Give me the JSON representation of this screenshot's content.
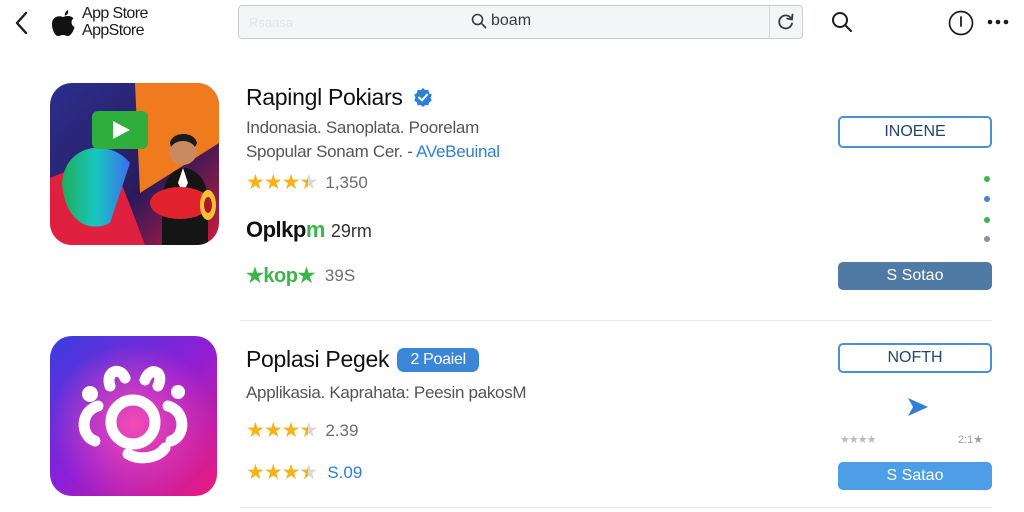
{
  "topbar": {
    "brand_line1": "App Store",
    "brand_line2": "AppStore",
    "search_placeholder": "Rsaasa",
    "search_query": "boam"
  },
  "apps": [
    {
      "title": "Rapingl Pokiars",
      "subtitle_line1": "Indonasia. Sanoplata. Poorelam",
      "subtitle_line2_prefix": "Spopular Sonam Cer. -",
      "subtitle_link": "AVeBeuinal",
      "rating_stars": 3.5,
      "rating_count": "1,350",
      "price_label": "Oplkp",
      "price_suffix": "m",
      "size": "29rm",
      "secondary_rating_label": "★kop★",
      "secondary_rating_value": "39S",
      "get_button": "INOENE",
      "action_button": "S Sotao"
    },
    {
      "title": "Poplasi Pegek",
      "badge": "2 Poaiel",
      "subtitle_line1": "Applikasia. Kaprahata: Peesin pakosM",
      "rating_stars": 3.5,
      "rating_count": "2.39",
      "rating2_stars": 3.5,
      "rating2_count": "S.09",
      "get_button": "NOFTH",
      "mini_rating_left": "★★★★",
      "mini_rating_right": "2:1★",
      "action_button": "S Satao"
    }
  ],
  "colors": {
    "accent_blue": "#4a90d9",
    "action_blue_dark": "#4f7aa3",
    "action_blue_light": "#4d9ee6",
    "star": "#f6b21b",
    "green": "#3bb54a"
  }
}
